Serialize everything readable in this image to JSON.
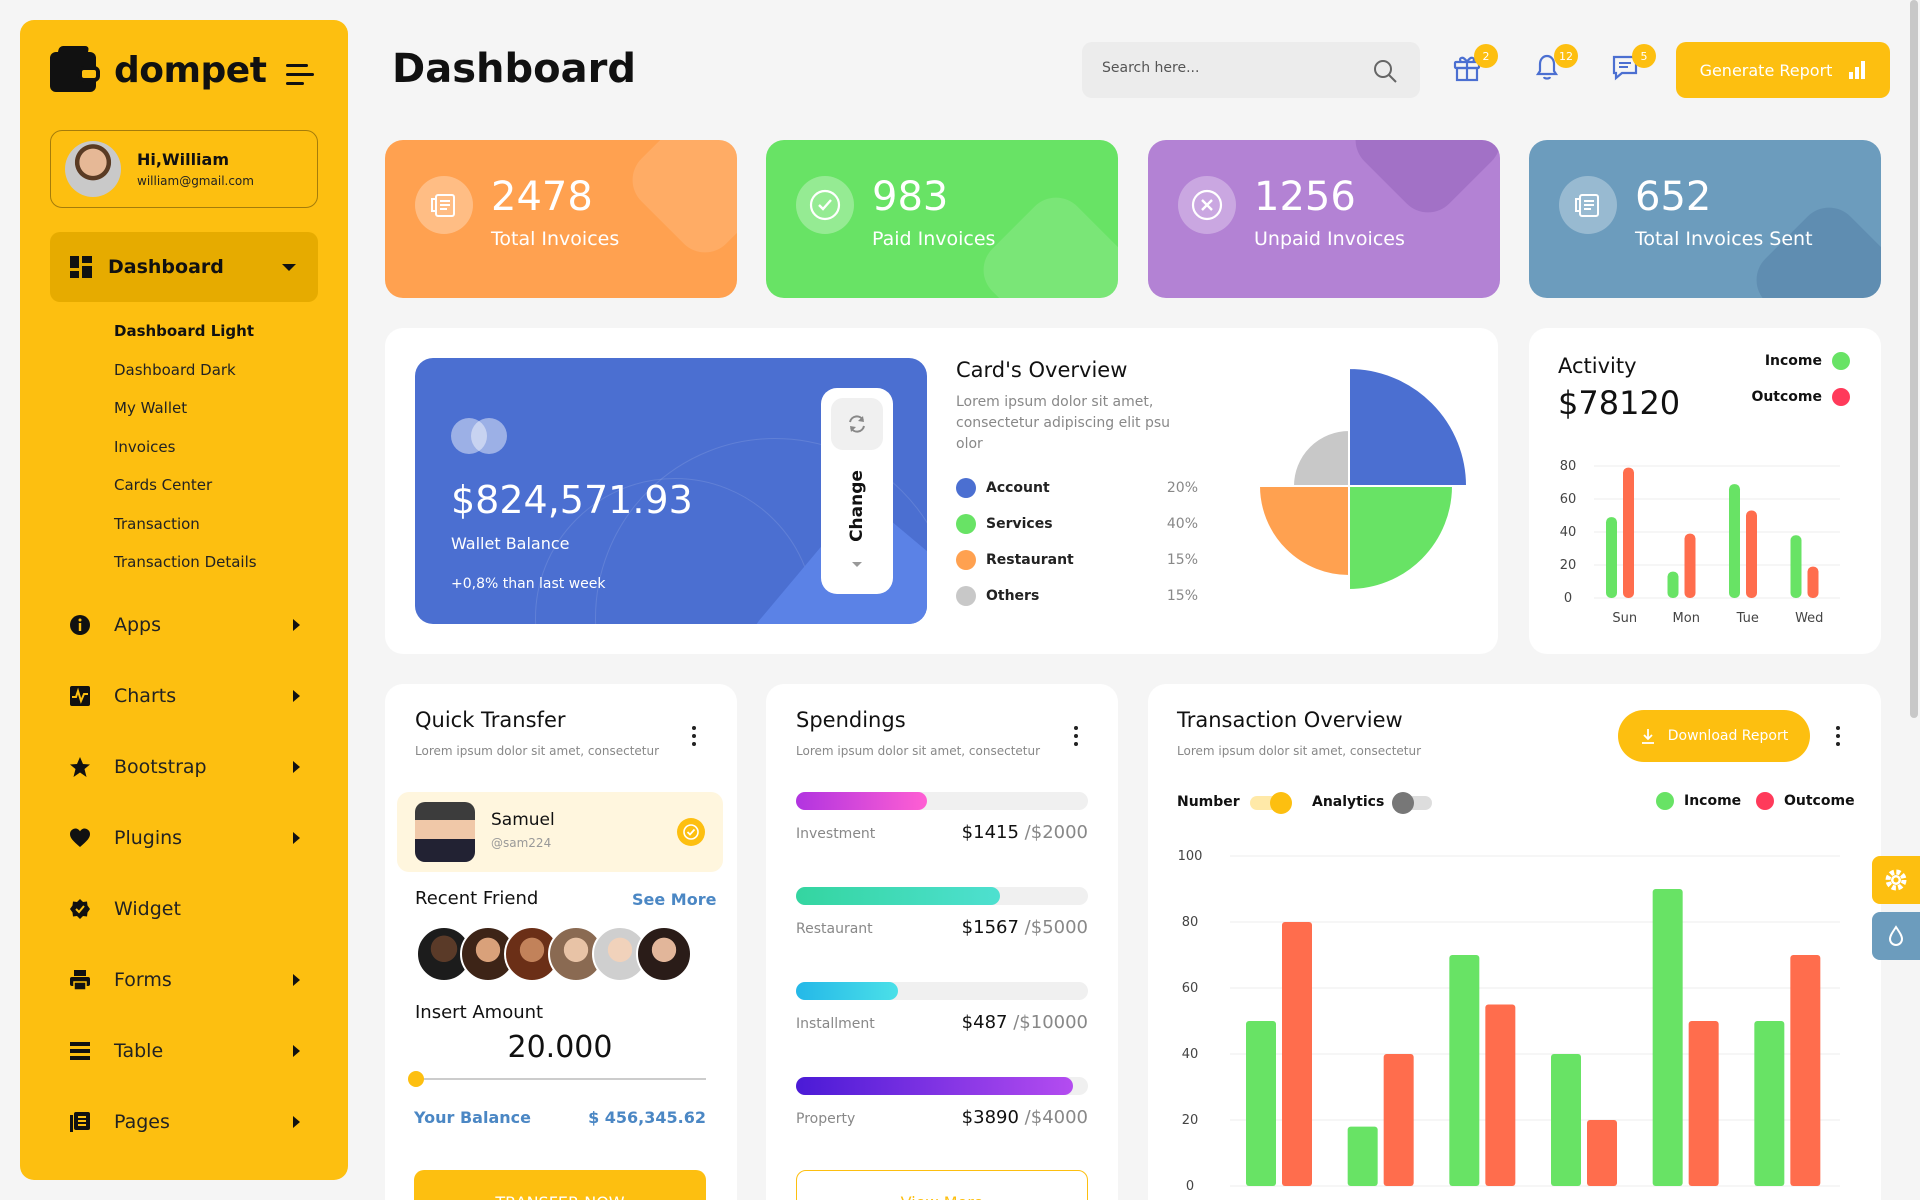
{
  "app": {
    "logo_text": "dompet",
    "page_title": "Dashboard",
    "accent": "#fdbf10"
  },
  "profile": {
    "greeting": "Hi,William",
    "email": "william@gmail.com"
  },
  "sidebar": {
    "active": {
      "label": "Dashboard",
      "icon": "dashboard-icon"
    },
    "submenu": [
      "Dashboard Light",
      "Dashboard Dark",
      "My Wallet",
      "Invoices",
      "Cards Center",
      "Transaction",
      "Transaction Details"
    ],
    "items": [
      {
        "label": "Apps",
        "icon": "info-icon"
      },
      {
        "label": "Charts",
        "icon": "chart-pulse-icon"
      },
      {
        "label": "Bootstrap",
        "icon": "star-icon"
      },
      {
        "label": "Plugins",
        "icon": "heart-icon"
      },
      {
        "label": "Widget",
        "icon": "badge-check-icon"
      },
      {
        "label": "Forms",
        "icon": "printer-icon"
      },
      {
        "label": "Table",
        "icon": "table-icon"
      },
      {
        "label": "Pages",
        "icon": "pages-icon"
      }
    ]
  },
  "header": {
    "search_placeholder": "Search here...",
    "badges": {
      "gift": "2",
      "bell": "12",
      "chat": "5"
    },
    "generate_label": "Generate Report"
  },
  "stats": [
    {
      "value": "2478",
      "label": "Total Invoices",
      "color": "#ffa150"
    },
    {
      "value": "983",
      "label": "Paid Invoices",
      "color": "#68e365"
    },
    {
      "value": "1256",
      "label": "Unpaid Invoices",
      "color": "#b382d4"
    },
    {
      "value": "652",
      "label": "Total Invoices Sent",
      "color": "#6c9cbd"
    }
  ],
  "wallet": {
    "balance": "$824,571.93",
    "label": "Wallet Balance",
    "change": "+0,8% than last week",
    "button": "Change"
  },
  "overview": {
    "title": "Card's Overview",
    "desc": "Lorem ipsum dolor sit amet, consectetur adipiscing elit psu olor",
    "legend": [
      {
        "name": "Account",
        "pct": "20%",
        "color": "#4b6fd1"
      },
      {
        "name": "Services",
        "pct": "40%",
        "color": "#68e365"
      },
      {
        "name": "Restaurant",
        "pct": "15%",
        "color": "#ffa150"
      },
      {
        "name": "Others",
        "pct": "15%",
        "color": "#c8c8c8"
      }
    ]
  },
  "activity": {
    "title": "Activity",
    "amount": "$78120",
    "income_label": "Income",
    "outcome_label": "Outcome"
  },
  "quick_transfer": {
    "title": "Quick Transfer",
    "desc": "Lorem ipsum dolor sit amet, consectetur",
    "friend_name": "Samuel",
    "friend_handle": "@sam224",
    "recent_label": "Recent Friend",
    "see_more": "See More",
    "insert_label": "Insert Amount",
    "amount": "20.000",
    "amount_fraction": 0,
    "balance_label": "Your Balance",
    "balance_value": "$ 456,345.62",
    "button": "TRANSFER NOW"
  },
  "spendings": {
    "title": "Spendings",
    "desc": "Lorem ipsum dolor sit amet, consectetur",
    "items": [
      {
        "label": "Investment",
        "spent": "$1415",
        "total": "/$2000",
        "fill": 0.45,
        "grad": [
          "#b134e0",
          "#ff5fd3"
        ]
      },
      {
        "label": "Restaurant",
        "spent": "$1567",
        "total": "/$5000",
        "fill": 0.7,
        "grad": [
          "#34d5a0",
          "#4ee0d0"
        ]
      },
      {
        "label": "Installment",
        "spent": "$487",
        "total": "/$10000",
        "fill": 0.35,
        "grad": [
          "#24b8e8",
          "#4be0e8"
        ]
      },
      {
        "label": "Property",
        "spent": "$3890",
        "total": "/$4000",
        "fill": 0.95,
        "grad": [
          "#4a1ad6",
          "#b44cf0"
        ]
      }
    ],
    "button": "View More"
  },
  "transaction": {
    "title": "Transaction Overview",
    "desc": "Lorem ipsum dolor sit amet, consectetur",
    "download_label": "Download Report",
    "number_label": "Number",
    "analytics_label": "Analytics",
    "number_on": true,
    "analytics_on": false,
    "income_label": "Income",
    "outcome_label": "Outcome"
  },
  "chart_data": [
    {
      "type": "pie",
      "categories": [
        "Account",
        "Services",
        "Restaurant",
        "Others"
      ],
      "values": [
        20,
        40,
        15,
        15
      ],
      "colors": [
        "#4b6fd1",
        "#68e365",
        "#ffa150",
        "#c8c8c8"
      ]
    },
    {
      "type": "bar",
      "categories": [
        "Sun",
        "Mon",
        "Tue",
        "Wed"
      ],
      "series": [
        {
          "name": "Income",
          "values": [
            49,
            16,
            69,
            38
          ],
          "color": "#68e365"
        },
        {
          "name": "Outcome",
          "values": [
            79,
            39,
            53,
            19
          ],
          "color": "#ff6d4d"
        }
      ],
      "yticks": [
        0,
        20,
        40,
        60,
        80
      ],
      "ylim": [
        0,
        80
      ],
      "grid": true
    },
    {
      "type": "bar",
      "series": [
        {
          "name": "Income",
          "values": [
            50,
            18,
            70,
            40,
            90,
            50
          ],
          "color": "#68e365"
        },
        {
          "name": "Outcome",
          "values": [
            80,
            40,
            55,
            20,
            50,
            70
          ],
          "color": "#ff6d4d"
        }
      ],
      "yticks": [
        0,
        20,
        40,
        60,
        80,
        100
      ],
      "ylim": [
        0,
        100
      ],
      "grid": true
    }
  ]
}
